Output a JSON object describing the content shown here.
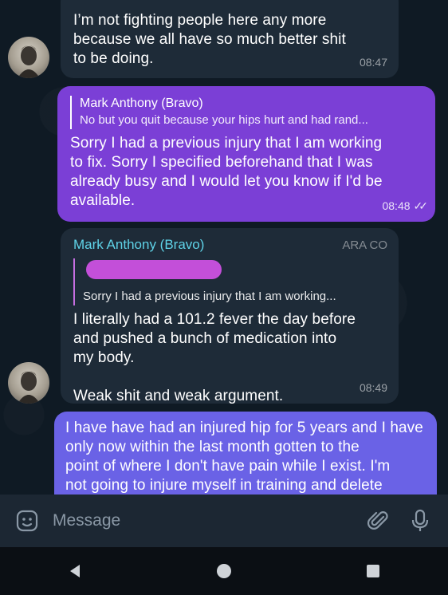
{
  "messages": [
    {
      "text": "I’m not fighting people here any more\nbecause we all have so much better shit\nto be doing.",
      "time": "08:47"
    },
    {
      "reply_name": "Mark Anthony (Bravo)",
      "reply_snippet": "No but you quit because your hips hurt and had rand...",
      "text": "Sorry I had a previous injury that I am working\nto fix. Sorry I specified beforehand that I was\nalready busy and I would let you know if I'd be\navailable.",
      "time": "08:48"
    },
    {
      "sender": "Mark Anthony (Bravo)",
      "tag": "ARA CO",
      "reply_snippet": "Sorry I had a previous injury that I am working...",
      "text": "I literally had a 101.2 fever the day before\nand pushed a bunch of medication into\nmy body.\n\nWeak shit and weak argument.",
      "time": "08:49"
    },
    {
      "text": "I have have had an injured hip for 5 years and I have\nonly now within the last month gotten to the\npoint of where I don't have pain while I exist. I'm\nnot going to injure myself in training and delete"
    }
  ],
  "input": {
    "placeholder": "Message"
  },
  "icons": {
    "emoji": "sticker-emoji-icon",
    "attach": "paperclip-icon",
    "mic": "microphone-icon",
    "back": "back-triangle-icon",
    "home": "home-circle-icon",
    "recents": "recents-square-icon"
  },
  "colors": {
    "background": "#0e1621",
    "incoming_bubble": "#1e2b38",
    "outgoing_bubble": "#7b3fd6",
    "sender_name": "#5fd3e8"
  }
}
